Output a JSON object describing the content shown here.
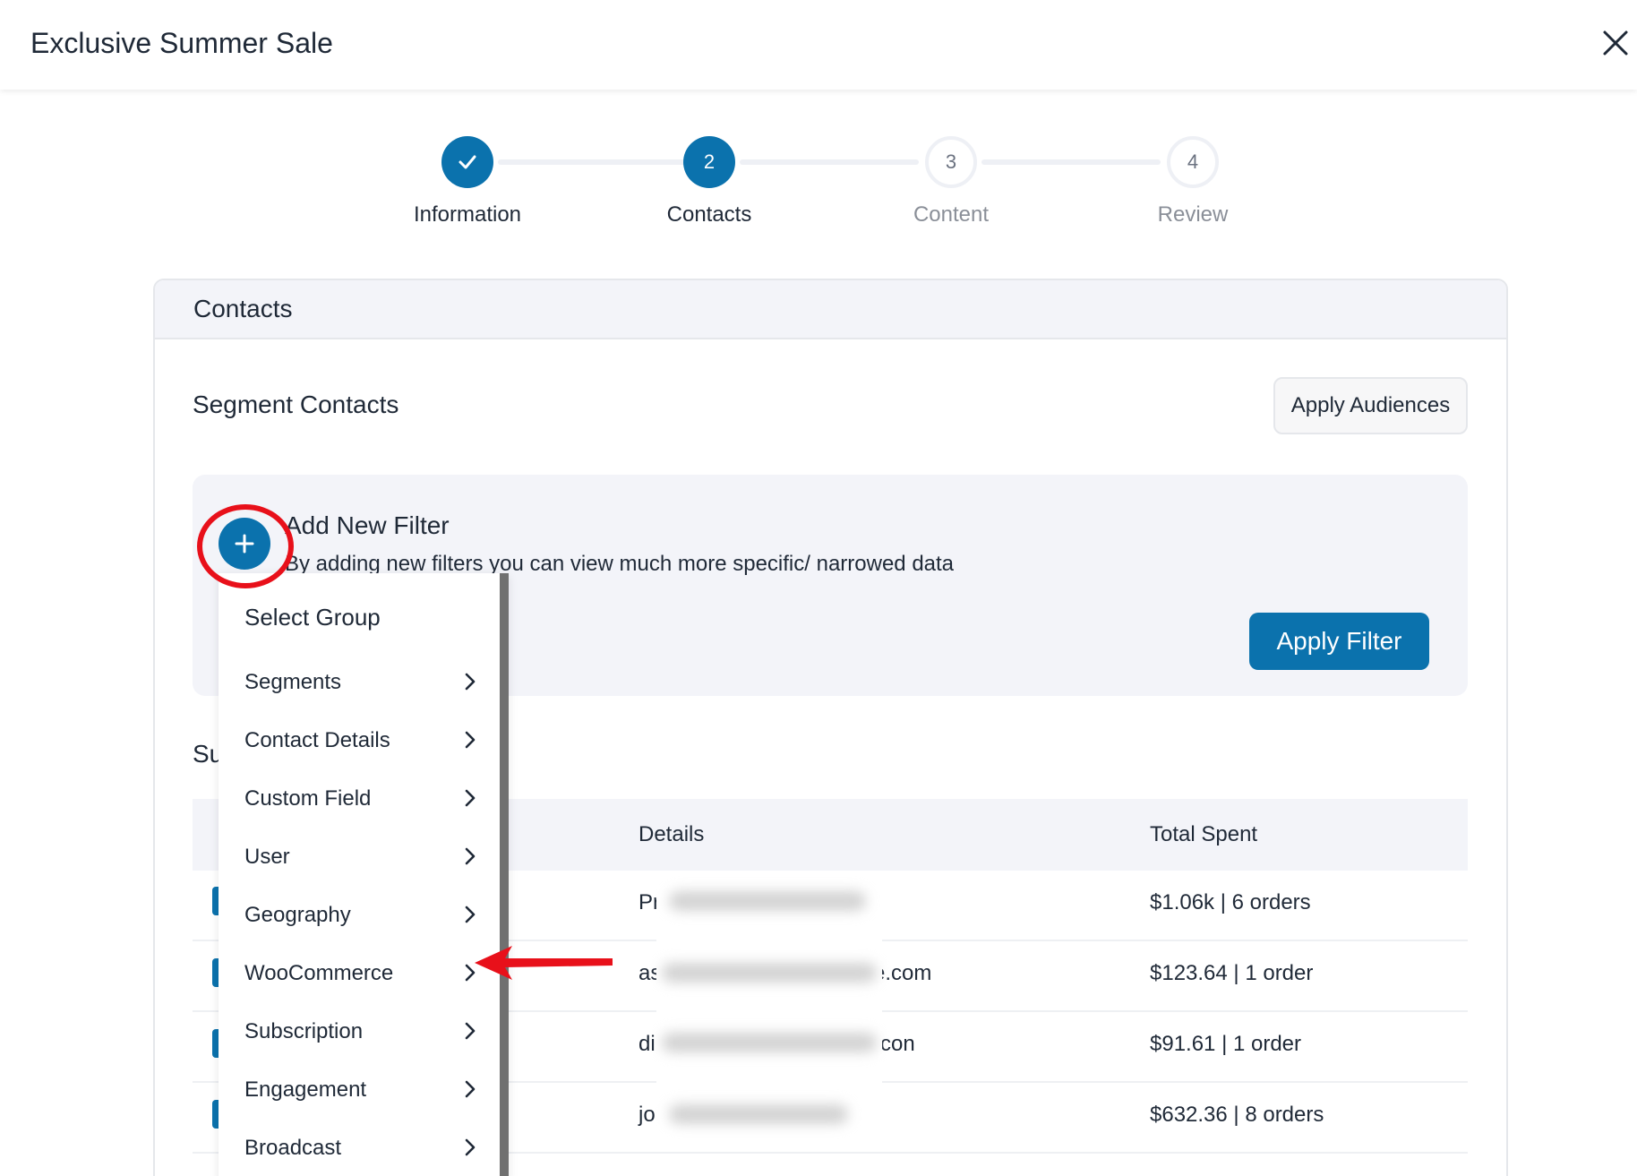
{
  "window": {
    "title": "Exclusive Summer Sale"
  },
  "stepper": {
    "steps": [
      {
        "number": "",
        "label": "Information",
        "state": "done"
      },
      {
        "number": "2",
        "label": "Contacts",
        "state": "active"
      },
      {
        "number": "3",
        "label": "Content",
        "state": "pending"
      },
      {
        "number": "4",
        "label": "Review",
        "state": "pending"
      }
    ]
  },
  "card": {
    "header": "Contacts"
  },
  "segment": {
    "title": "Segment Contacts",
    "apply_audiences_label": "Apply Audiences"
  },
  "filter": {
    "title": "Add New Filter",
    "description": "By adding new filters you can view much more specific/ narrowed data",
    "apply_label": "Apply Filter"
  },
  "summary": {
    "title_partial": "Su"
  },
  "table": {
    "headers": {
      "details": "Details",
      "total_spent": "Total Spent"
    },
    "rows": [
      {
        "details_visible": "Pr",
        "total_spent": "$1.06k | 6 orders"
      },
      {
        "details_visible": "as",
        "details_suffix": "e.com",
        "total_spent": "$123.64 | 1 order"
      },
      {
        "details_visible": "di",
        "details_suffix": "con",
        "total_spent": "$91.61 | 1 order"
      },
      {
        "details_visible": "jo",
        "total_spent": "$632.36 | 8 orders"
      }
    ]
  },
  "dropdown": {
    "header": "Select Group",
    "items": [
      "Segments",
      "Contact Details",
      "Custom Field",
      "User",
      "Geography",
      "WooCommerce",
      "Subscription",
      "Engagement",
      "Broadcast"
    ]
  },
  "colors": {
    "primary": "#0b72ad",
    "annotation_red": "#e8101a",
    "panel_bg": "#f3f4f9"
  }
}
